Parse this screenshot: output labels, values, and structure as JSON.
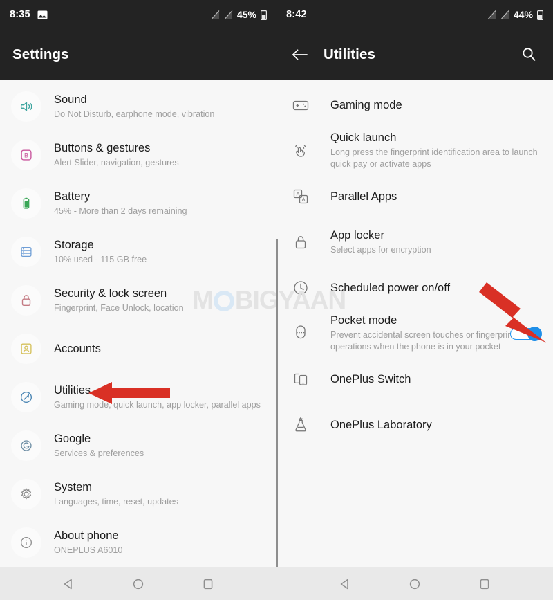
{
  "left": {
    "statusbar": {
      "time": "8:35",
      "battery_percent": "45%",
      "icons": [
        "image-icon",
        "no-sim-icon",
        "no-sim-icon",
        "battery-icon"
      ]
    },
    "appbar": {
      "title": "Settings"
    },
    "items": [
      {
        "title": "Sound",
        "subtitle": "Do Not Disturb, earphone mode, vibration",
        "icon": "sound-icon",
        "color": "#3fa6a0"
      },
      {
        "title": "Buttons & gestures",
        "subtitle": "Alert Slider, navigation, gestures",
        "icon": "buttons-gestures-icon",
        "color": "#c9559c"
      },
      {
        "title": "Battery",
        "subtitle": "45% - More than 2 days remaining",
        "icon": "battery-icon",
        "color": "#3aa757"
      },
      {
        "title": "Storage",
        "subtitle": "10% used - 115 GB free",
        "icon": "storage-icon",
        "color": "#6f9ed6"
      },
      {
        "title": "Security & lock screen",
        "subtitle": "Fingerprint, Face Unlock, location",
        "icon": "lock-icon",
        "color": "#c47b83"
      },
      {
        "title": "Accounts",
        "subtitle": "",
        "icon": "account-icon",
        "color": "#d6c25e"
      },
      {
        "title": "Utilities",
        "subtitle": "Gaming mode, quick launch, app locker, parallel apps",
        "icon": "utilities-icon",
        "color": "#4b86b4"
      },
      {
        "title": "Google",
        "subtitle": "Services & preferences",
        "icon": "google-icon",
        "color": "#6b8ca3"
      },
      {
        "title": "System",
        "subtitle": "Languages, time, reset, updates",
        "icon": "gear-icon",
        "color": "#8b8b8b"
      },
      {
        "title": "About phone",
        "subtitle": "ONEPLUS A6010",
        "icon": "info-icon",
        "color": "#8b8b8b"
      }
    ]
  },
  "right": {
    "statusbar": {
      "time": "8:42",
      "battery_percent": "44%",
      "icons": [
        "no-sim-icon",
        "no-sim-icon",
        "battery-icon"
      ]
    },
    "appbar": {
      "title": "Utilities",
      "back": "back-arrow-icon",
      "search": "search-icon"
    },
    "items": [
      {
        "title": "Gaming mode",
        "subtitle": "",
        "icon": "gamepad-icon",
        "toggle": null
      },
      {
        "title": "Quick launch",
        "subtitle": "Long press the fingerprint identification area to launch quick pay or activate apps",
        "icon": "fingerprint-tap-icon",
        "toggle": null
      },
      {
        "title": "Parallel Apps",
        "subtitle": "",
        "icon": "parallel-apps-icon",
        "toggle": null
      },
      {
        "title": "App locker",
        "subtitle": "Select apps for encryption",
        "icon": "lock-icon",
        "toggle": null
      },
      {
        "title": "Scheduled power on/off",
        "subtitle": "",
        "icon": "clock-icon",
        "toggle": null
      },
      {
        "title": "Pocket mode",
        "subtitle": "Prevent accidental screen touches or fingerprint operations when the phone is in your pocket",
        "icon": "pocket-icon",
        "toggle": "on"
      },
      {
        "title": "OnePlus Switch",
        "subtitle": "",
        "icon": "device-switch-icon",
        "toggle": null
      },
      {
        "title": "OnePlus Laboratory",
        "subtitle": "",
        "icon": "flask-icon",
        "toggle": null
      }
    ]
  },
  "watermark": {
    "text_before": "M",
    "ring": "O",
    "text_after": "BIGYAAN"
  },
  "navbar": {
    "back": "nav-back-icon",
    "home": "nav-home-icon",
    "recents": "nav-recents-icon"
  },
  "annotations": {
    "arrow_color": "#d93025",
    "left_arrow_target": "Utilities",
    "right_arrow_target": "Pocket mode toggle"
  },
  "colors": {
    "statusbar_bg": "#232323",
    "page_bg": "#f7f7f7",
    "toggle_on": "#1f8fe8",
    "navbar_bg": "#e9e9e9"
  }
}
